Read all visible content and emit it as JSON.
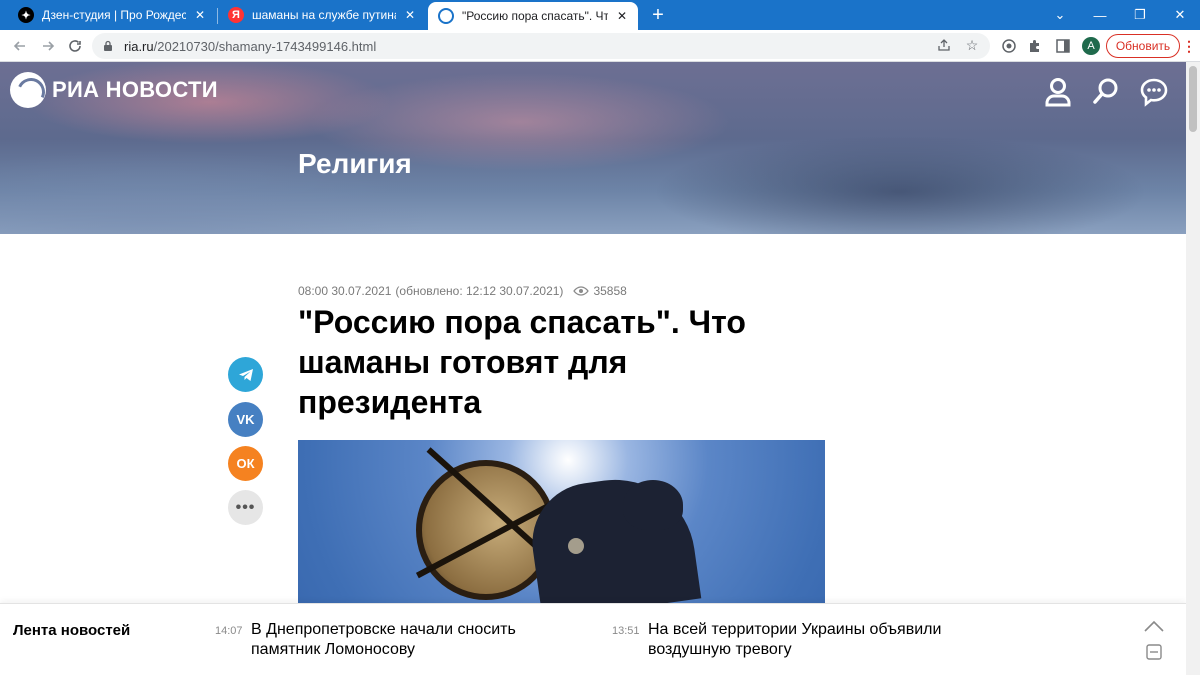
{
  "browser": {
    "tabs": [
      {
        "title": "Дзен-студия | Про Рождество, г",
        "favicon": "dzen-icon"
      },
      {
        "title": "шаманы на службе путина — Я",
        "favicon": "yandex-icon"
      },
      {
        "title": "\"Россию пора спасать\". Что шам",
        "favicon": "ria-icon",
        "active": true
      }
    ],
    "new_tab": "+",
    "window_controls": {
      "chevron": "⌄",
      "minimize": "—",
      "restore": "❐",
      "close": "✕"
    },
    "url": {
      "host": "ria.ru",
      "path": "/20210730/shamany-1743499146.html"
    },
    "avatar_letter": "A",
    "update_label": "Обновить",
    "menu_glyph": "⋮"
  },
  "site": {
    "logo_text": "РИА НОВОСТИ",
    "header_icons": [
      "user-icon",
      "search-icon",
      "chat-icon"
    ],
    "rubric": "Религия"
  },
  "article": {
    "published": "08:00 30.07.2021",
    "updated": "(обновлено: 12:12 30.07.2021)",
    "views": "35858",
    "headline": "\"Россию пора спасать\". Что шаманы готовят для президента",
    "share": {
      "telegram": "telegram-icon",
      "vk_label": "VK",
      "ok_label": "ОК",
      "more_label": "•••"
    }
  },
  "ticker": {
    "title": "Лента новостей",
    "items": [
      {
        "time": "14:07",
        "text": "В Днепропетровске начали сносить памятник Ломоносову"
      },
      {
        "time": "13:51",
        "text": "На всей территории Украины объявили воздушную тревогу"
      }
    ]
  },
  "colors": {
    "tabstrip": "#1a73c9",
    "telegram": "#2ea6d8",
    "vk": "#4680c2",
    "ok": "#f58220",
    "update": "#d93025"
  }
}
